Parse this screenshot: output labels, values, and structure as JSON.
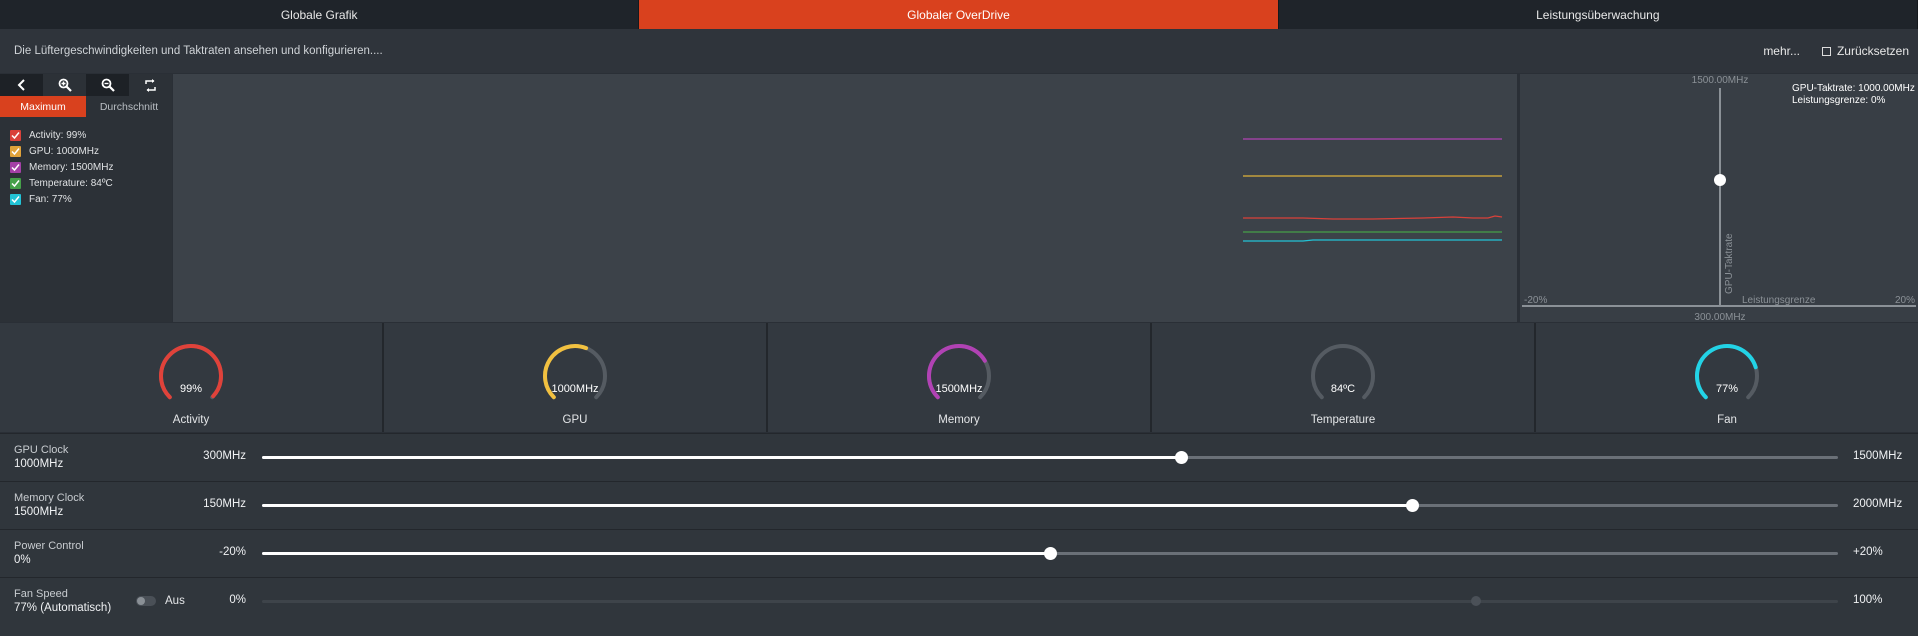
{
  "tabs": [
    {
      "label": "Globale Grafik"
    },
    {
      "label": "Globaler OverDrive"
    },
    {
      "label": "Leistungsüberwachung"
    }
  ],
  "header": {
    "description": "Die Lüftergeschwindigkeiten und Taktraten ansehen und konfigurieren....",
    "more": "mehr...",
    "reset": "Zurücksetzen"
  },
  "toolbar_icons": [
    "back-icon",
    "zoom-in-icon",
    "zoom-out-icon",
    "refresh-icon"
  ],
  "modes": {
    "maximum": "Maximum",
    "average": "Durchschnitt"
  },
  "legend": [
    {
      "label": "Activity: 99%",
      "color": "#d9413a"
    },
    {
      "label": "GPU: 1000MHz",
      "color": "#e0a23a"
    },
    {
      "label": "Memory: 1500MHz",
      "color": "#a340a6"
    },
    {
      "label": "Temperature: 84ºC",
      "color": "#45a049"
    },
    {
      "label": "Fan: 77%",
      "color": "#22c3d6"
    }
  ],
  "plot": {
    "top_label": "1500.00MHz",
    "bottom_label": "300.00MHz",
    "left_label": "-20%",
    "right_label": "20%",
    "y_axis_label": "GPU-Taktrate",
    "x_axis_label": "Leistungsgrenze",
    "info_line1": "GPU-Taktrate: 1000.00MHz",
    "info_line2": "Leistungsgrenze: 0%"
  },
  "gauges": [
    {
      "value": "99%",
      "name": "Activity",
      "fraction": 0.99,
      "color": "#e0423a"
    },
    {
      "value": "1000MHz",
      "name": "GPU",
      "fraction": 0.58,
      "color": "#f2c140"
    },
    {
      "value": "1500MHz",
      "name": "Memory",
      "fraction": 0.72,
      "color": "#b142b4"
    },
    {
      "value": "84ºC",
      "name": "Temperature",
      "fraction": 0,
      "color": "#6b7178"
    },
    {
      "value": "77%",
      "name": "Fan",
      "fraction": 0.77,
      "color": "#22d3e6"
    }
  ],
  "sliders": {
    "gpu_clock": {
      "title": "GPU Clock",
      "value": "1000MHz",
      "min": "300MHz",
      "max": "1500MHz",
      "fraction": 0.583
    },
    "memory_clock": {
      "title": "Memory Clock",
      "value": "1500MHz",
      "min": "150MHz",
      "max": "2000MHz",
      "fraction": 0.73
    },
    "power_control": {
      "title": "Power Control",
      "value": "0%",
      "min": "-20%",
      "max": "+20%",
      "fraction": 0.5
    },
    "fan_speed": {
      "title": "Fan Speed",
      "value": "77% (Automatisch)",
      "toggle_label": "Aus",
      "min": "0%",
      "max": "100%",
      "fraction": 0.77
    }
  }
}
